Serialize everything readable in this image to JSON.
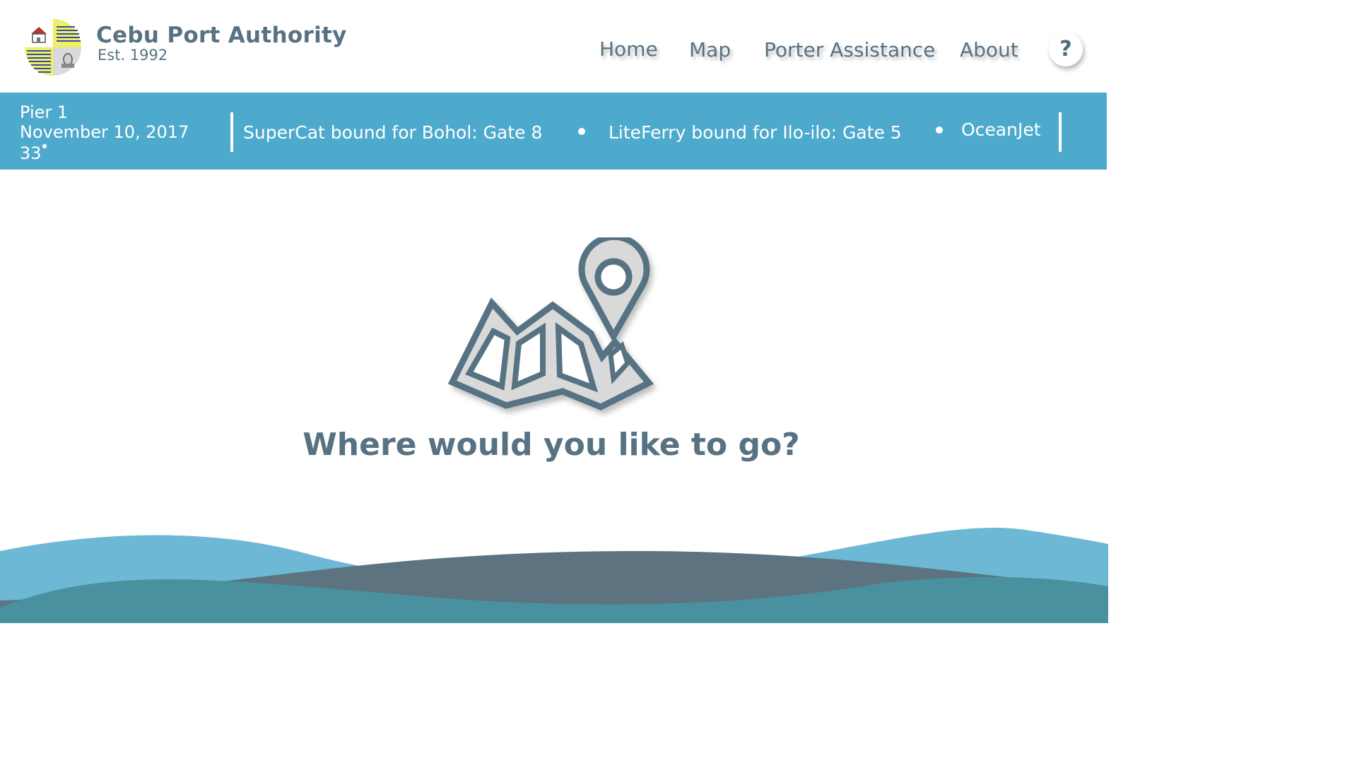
{
  "header": {
    "title": "Cebu Port Authority",
    "subtitle": "Est. 1992"
  },
  "nav": {
    "items": [
      {
        "label": "Home"
      },
      {
        "label": "Map"
      },
      {
        "label": "Porter Assistance"
      },
      {
        "label": "About"
      }
    ],
    "help_label": "?"
  },
  "info_bar": {
    "location": "Pier 1",
    "date": "November 10, 2017",
    "temperature": "33",
    "ticker": [
      "SuperCat bound for Bohol: Gate 8",
      "LiteFerry bound for Ilo-ilo: Gate 5",
      "OceanJet"
    ]
  },
  "main": {
    "prompt": "Where would you like to go?",
    "icon": "map-pin-icon"
  },
  "colors": {
    "text": "#577283",
    "info_bar": "#4eaacd",
    "wave_light": "#6db8d4",
    "wave_dark": "#5d7480",
    "wave_teal": "#4a919f"
  }
}
